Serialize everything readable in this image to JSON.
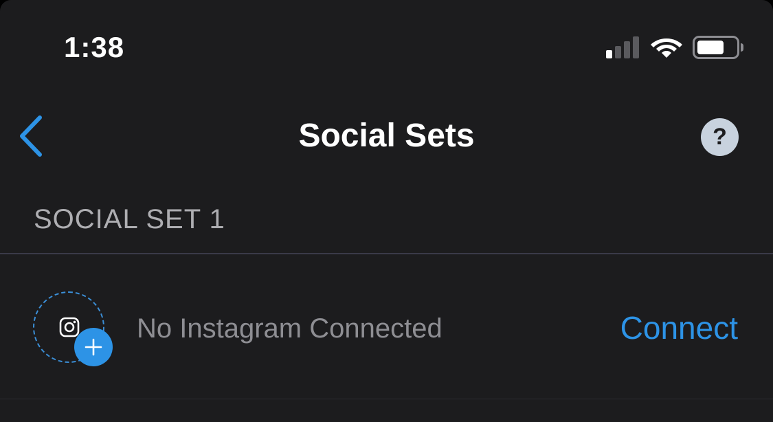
{
  "status_bar": {
    "time": "1:38",
    "signal_icon": "cellular-signal-icon",
    "wifi_icon": "wifi-icon",
    "battery_icon": "battery-icon",
    "battery_level": 0.65
  },
  "nav": {
    "back_icon": "chevron-left-icon",
    "title": "Social Sets",
    "help_label": "?"
  },
  "section": {
    "header": "SOCIAL SET 1"
  },
  "row": {
    "icon": "instagram-icon",
    "badge_icon": "plus-icon",
    "label": "No Instagram Connected",
    "action_label": "Connect"
  },
  "colors": {
    "background": "#1c1c1e",
    "accent": "#2d93e6",
    "secondary_text": "#8e8e93",
    "help_bg": "#c8d2de"
  }
}
